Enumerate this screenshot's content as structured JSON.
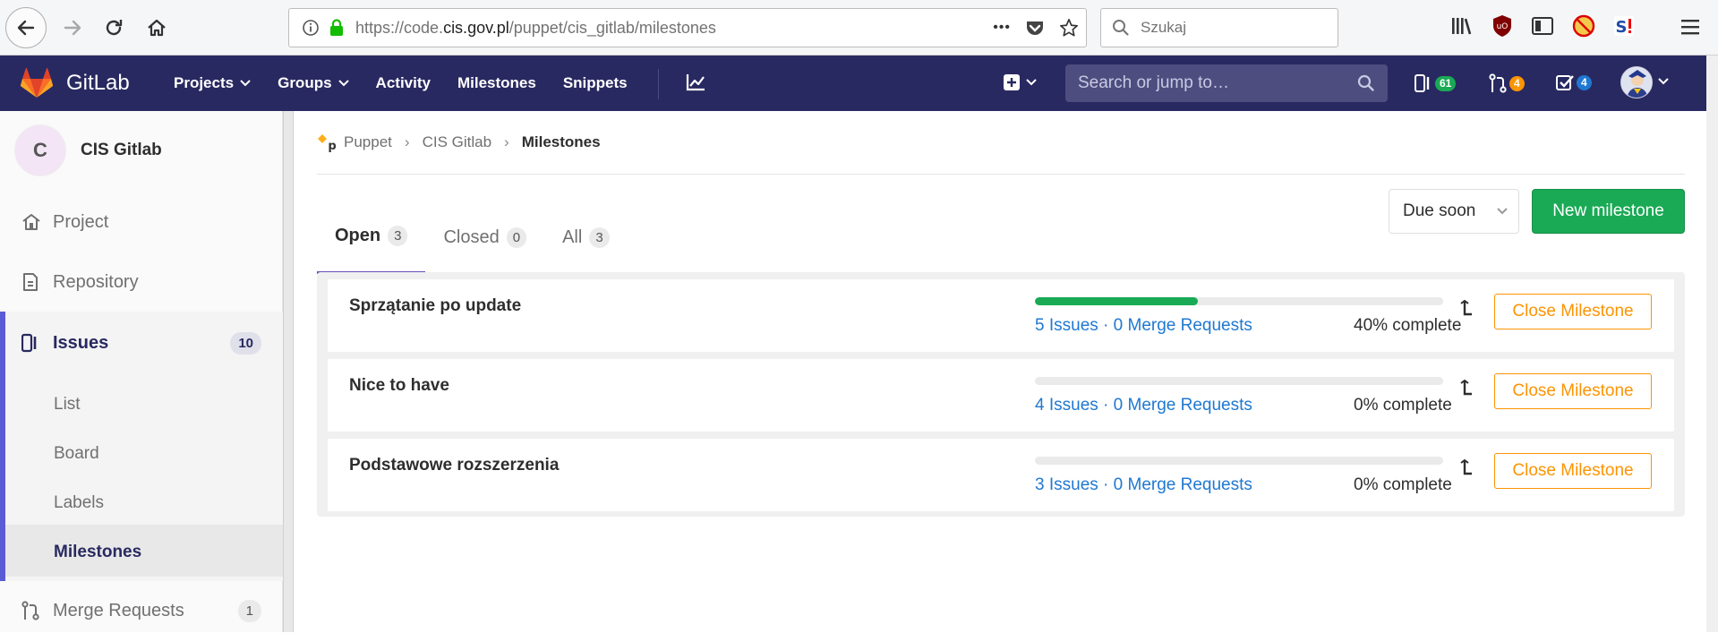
{
  "browser": {
    "url_prefix": "https://code.",
    "url_domain": "cis.gov.pl",
    "url_path": "/puppet/cis_gitlab/milestones",
    "search_placeholder": "Szukaj",
    "more_label": "•••"
  },
  "header": {
    "brand": "GitLab",
    "nav": [
      "Projects",
      "Groups",
      "Activity",
      "Milestones",
      "Snippets"
    ],
    "search_placeholder": "Search or jump to…",
    "issues_count": "61",
    "mr_count": "4",
    "todos_count": "4"
  },
  "sidebar": {
    "project_initial": "C",
    "project_name": "CIS Gitlab",
    "items": [
      {
        "label": "Project"
      },
      {
        "label": "Repository"
      },
      {
        "label": "Issues",
        "count": "10"
      },
      {
        "label": "Merge Requests",
        "count": "1"
      }
    ],
    "issue_subitems": [
      "List",
      "Board",
      "Labels",
      "Milestones"
    ]
  },
  "breadcrumb": [
    "Puppet",
    "CIS Gitlab",
    "Milestones"
  ],
  "tabs": [
    {
      "label": "Open",
      "count": "3"
    },
    {
      "label": "Closed",
      "count": "0"
    },
    {
      "label": "All",
      "count": "3"
    }
  ],
  "sort_label": "Due soon",
  "new_milestone_label": "New milestone",
  "milestones": [
    {
      "title": "Sprzątanie po update",
      "links": "5 Issues · 0 Merge Requests",
      "progress": "40% complete",
      "fraction": 0.4,
      "action": "Close Milestone"
    },
    {
      "title": "Nice to have",
      "links": "4 Issues · 0 Merge Requests",
      "progress": "0% complete",
      "fraction": 0,
      "action": "Close Milestone"
    },
    {
      "title": "Podstawowe rozszerzenia",
      "links": "3 Issues · 0 Merge Requests",
      "progress": "0% complete",
      "fraction": 0,
      "action": "Close Milestone"
    }
  ],
  "colors": {
    "header": "#292961",
    "accent_green": "#1aaa55",
    "accent_orange": "#fc9403",
    "link_blue": "#1f78d1"
  }
}
